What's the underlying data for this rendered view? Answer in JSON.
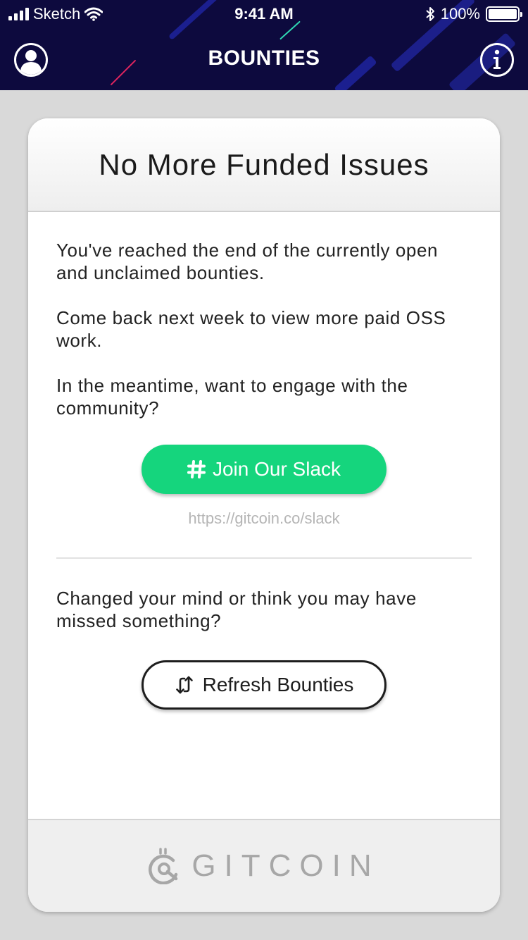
{
  "status_bar": {
    "carrier": "Sketch",
    "time": "9:41 AM",
    "battery": "100%"
  },
  "nav": {
    "title": "BOUNTIES",
    "left_icon": "profile-icon",
    "right_icon": "info-icon"
  },
  "card": {
    "title": "No More Funded Issues",
    "paragraphs": [
      "You've reached the end of the currently open and unclaimed bounties.",
      "Come back next week to view more paid OSS work.",
      "In the meantime, want to engage with the community?"
    ],
    "slack_button": {
      "label": "Join Our Slack",
      "icon": "hash-icon"
    },
    "slack_url": "https://gitcoin.co/slack",
    "refresh_prompt": "Changed your mind or think you may have missed something?",
    "refresh_button": {
      "label": "Refresh Bounties",
      "icon": "refresh-icon"
    },
    "footer_brand": "GITCOIN"
  },
  "colors": {
    "header_bg": "#0d0a3e",
    "slack_green": "#15d57d",
    "page_bg": "#d9d9d9",
    "muted_text": "#b5b5b5"
  }
}
